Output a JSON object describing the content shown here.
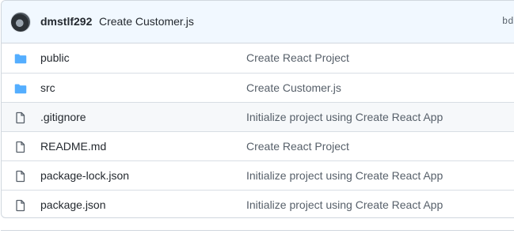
{
  "commit": {
    "author": "dmstlf292",
    "message": "Create Customer.js",
    "hash_partial": "bd"
  },
  "files": [
    {
      "type": "folder",
      "icon": "folder-icon",
      "name": "public",
      "message": "Create React Project"
    },
    {
      "type": "folder",
      "icon": "folder-icon",
      "name": "src",
      "message": "Create Customer.js"
    },
    {
      "type": "file",
      "icon": "file-icon",
      "name": ".gitignore",
      "message": "Initialize project using Create React App"
    },
    {
      "type": "file",
      "icon": "file-icon",
      "name": "README.md",
      "message": "Create React Project"
    },
    {
      "type": "file",
      "icon": "file-icon",
      "name": "package-lock.json",
      "message": "Initialize project using Create React App"
    },
    {
      "type": "file",
      "icon": "file-icon",
      "name": "package.json",
      "message": "Initialize project using Create React App"
    }
  ],
  "colors": {
    "folder": "#54aeff",
    "file": "#57606a",
    "header_bg": "#f1f8ff"
  }
}
